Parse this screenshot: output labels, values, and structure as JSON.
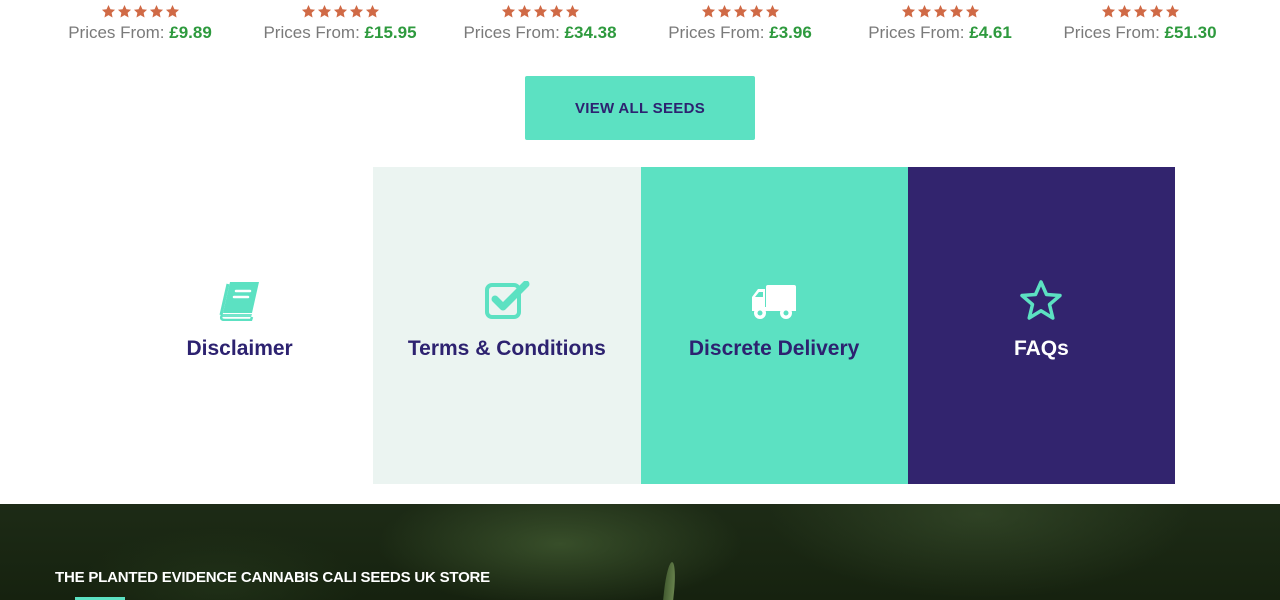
{
  "products": [
    {
      "rating": 5,
      "price_prefix": "Prices From: ",
      "price": "£9.89"
    },
    {
      "rating": 5,
      "price_prefix": "Prices From: ",
      "price": "£15.95"
    },
    {
      "rating": 5,
      "price_prefix": "Prices From: ",
      "price": "£34.38"
    },
    {
      "rating": 5,
      "price_prefix": "Prices From: ",
      "price": "£3.96"
    },
    {
      "rating": 5,
      "price_prefix": "Prices From: ",
      "price": "£4.61"
    },
    {
      "rating": 5,
      "price_prefix": "Prices From: ",
      "price": "£51.30"
    }
  ],
  "view_all_button": {
    "label": "VIEW ALL SEEDS"
  },
  "info_tiles": [
    {
      "label": "Disclaimer",
      "icon": "book-icon"
    },
    {
      "label": "Terms & Conditions",
      "icon": "checkbox-check-icon"
    },
    {
      "label": "Discrete Delivery",
      "icon": "truck-icon"
    },
    {
      "label": "FAQs",
      "icon": "star-outline-icon"
    }
  ],
  "banner": {
    "title": "THE PLANTED EVIDENCE CANNABIS CALI SEEDS UK STORE"
  },
  "colors": {
    "star": "#d06a46",
    "price_green": "#2e9a3e",
    "mint": "#5ce1c2",
    "navy": "#32246e",
    "tile_light": "#ebf4f1"
  }
}
